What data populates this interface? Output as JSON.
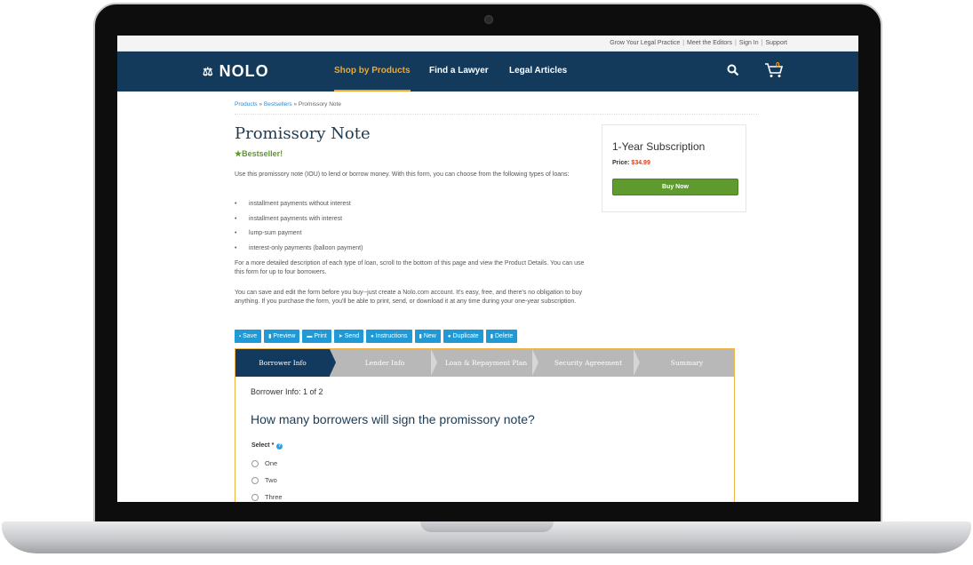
{
  "utility": {
    "links": [
      "Grow Your Legal Practice",
      "Meet the Editors",
      "Sign In",
      "Support"
    ]
  },
  "nav": {
    "logo": "NOLO",
    "items": [
      "Shop by Products",
      "Find a Lawyer",
      "Legal Articles"
    ],
    "active": "Shop by Products",
    "cart_count": "0"
  },
  "breadcrumb": {
    "items": [
      "Products",
      "Bestsellers",
      "Promissory Note"
    ]
  },
  "product": {
    "title": "Promissory Note",
    "badge": "Bestseller!",
    "intro": "Use this promissory note (IOU) to lend or borrow money. With this form, you can choose from the following types of loans:",
    "loan_types": [
      "installment payments without interest",
      "installment payments with interest",
      "lump-sum payment",
      "interest-only payments (balloon payment)"
    ],
    "para2": "For a more detailed description of each type of loan, scroll to the bottom of this page and view the Product Details. You can use this form for up to four borrowers.",
    "para3": "You can save and edit the form before you buy--just create a Nolo.com account. It's easy, free, and there's no obligation to buy anything. If you purchase the form, you'll be able to print, send, or download it at any time during your one-year subscription."
  },
  "subscription": {
    "title": "1-Year Subscription",
    "price_label": "Price:",
    "price": "$34.99",
    "buy_label": "Buy Now"
  },
  "toolbar": {
    "buttons": [
      "Save",
      "Preview",
      "Print",
      "Send",
      "Instructions",
      "New",
      "Duplicate",
      "Delete"
    ]
  },
  "wizard": {
    "steps": [
      "Borrower Info",
      "Lender Info",
      "Loan & Repayment Plan",
      "Security Agreement",
      "Summary"
    ],
    "active_step": "Borrower Info",
    "progress_label": "Borrower Info:",
    "progress_value": "1 of 2",
    "question": "How many borrowers will sign the promissory note?",
    "select_label": "Select *",
    "options": [
      "One",
      "Two",
      "Three"
    ]
  },
  "colors": {
    "navbar": "#133a5a",
    "accent": "#f6a623",
    "buy_button": "#5e9a2d",
    "toolbar_button": "#1f9ad6"
  }
}
